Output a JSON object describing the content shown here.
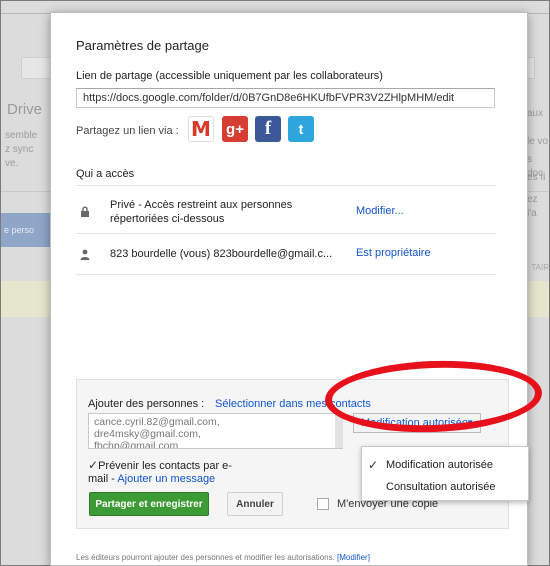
{
  "background": {
    "app_name": "Drive",
    "left_snippets": [
      "semble",
      "z sync",
      "ve."
    ],
    "left_button": "e perso",
    "right_snippets": [
      "aux",
      "le vo",
      "s doc",
      "es fi",
      "ez l'a"
    ],
    "right_label": "TAIR"
  },
  "dialog": {
    "title": "Paramètres de partage",
    "link_label": "Lien de partage (accessible uniquement par les collaborateurs)",
    "link_value": "https://docs.google.com/folder/d/0B7GnD8e6HKUfbFVPR3V2ZHlpMHM/edit",
    "share_via_label": "Partagez un lien via :",
    "social": {
      "gmail_glyph": "M",
      "gplus_glyph": "g+",
      "facebook_glyph": "f",
      "twitter_glyph": "t"
    },
    "access_label": "Qui a accès",
    "access_rows": [
      {
        "icon": "lock-icon",
        "text_line1": "Privé - Accès restreint aux personnes",
        "text_line2": "répertoriées ci-dessous",
        "action": "Modifier..."
      },
      {
        "icon": "person-icon",
        "text_line1": "823 bourdelle (vous)  823bourdelle@gmail.c...",
        "action": "Est propriétaire"
      }
    ],
    "add_people": {
      "label": "Ajouter des personnes :",
      "select_contacts": "Sélectionner dans mes contacts",
      "emails": [
        "cance.cyril.82@gmail.com,",
        "dre4msky@gmail.com,",
        "...",
        "fbchp@gmail.com"
      ],
      "permission_selected": "Modification autorisée",
      "permission_options": [
        "Modification autorisée",
        "Consultation autorisée"
      ],
      "notify_label_line1": "Prévenir les contacts par e-",
      "notify_label_line2": "mail",
      "notify_sep": " - ",
      "add_message": "Ajouter un message",
      "save_button": "Partager et enregistrer",
      "cancel_button": "Annuler",
      "send_copy": "M'envoyer une copie"
    },
    "footer": {
      "text": "Les éditeurs pourront ajouter des personnes et modifier les autorisations.",
      "link": "[Modifier]"
    }
  },
  "annotation_color": "#e8101a"
}
